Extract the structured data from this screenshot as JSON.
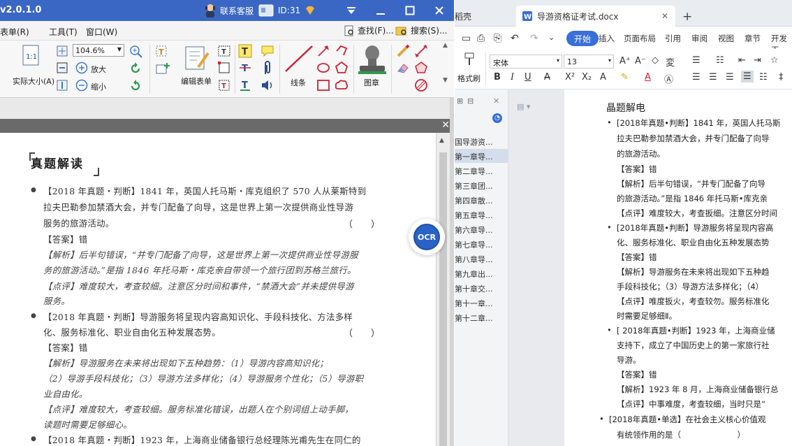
{
  "pdf": {
    "title": {
      "version": "v2.0.1.0",
      "service": "联系客服",
      "id_label": "ID:31"
    },
    "menu": [
      "表单(R)",
      "工具(T)",
      "窗口(W)"
    ],
    "menu_right": [
      "查找(F)...",
      "搜索(S)..."
    ],
    "ribbon": {
      "actual_size": "实际大小(A)",
      "zoom_value": "104.6%",
      "zoom_in": "放大",
      "zoom_out": "缩小",
      "edit_form": "编辑表单",
      "lines": "线条",
      "stamp": "图章"
    },
    "page": {
      "section_title": "真题解读",
      "lines": [
        "【2018 年真题・判断】1841 年，英国人托马斯・库克组织了 570 人从莱斯特到",
        "拉夫巴勒参加禁酒大会，并专门配备了向导，这是世界上第一次提供商业性导游",
        "服务的旅游活动。",
        "【答案】错",
        "【解析】后半句错误，“并专门配备了向导，这是世界上第一次提供商业性导游服",
        "务的旅游活动。”是指 1846 年托马斯・库克亲自带领一个旅行团到苏格兰旅行。",
        "【点评】难度较大，考查较细。注意区分时间和事件，“禁酒大会”并未提供导游",
        "服务。",
        "【2018 年真题・判断】导游服务将呈现内容高知识化、手段科技化、方法多样",
        "化、服务标准化、职业自由化五种发展态势。",
        "【答案】错",
        "【解析】导游服务在未来将出现如下五种趋势：（1）导游内容高知识化；",
        "（2）导游手段科技化；（3）导游方法多样化；（4）导游服务个性化；（5）导游职",
        "业自由化。",
        "【点评】难度较大，考查较细。服务标准化错误，出题人在个别词组上动手脚，",
        "读题时需要足够细心。",
        "【2018 年真题・判断】1923 年，上海商业储备银行总经理陈光甫先生在同仁的"
      ],
      "paren": "（　　）"
    },
    "ocr_label": "OCR"
  },
  "wps": {
    "tabs": [
      "稻壳",
      "导游资格证考试.docx"
    ],
    "new_tab": "+",
    "menu": [
      "开始",
      "插入",
      "页面布局",
      "引用",
      "审阅",
      "视图",
      "章节",
      "开发工"
    ],
    "format_painter": "格式刷",
    "font_name": "宋体",
    "font_size": "13",
    "nav": {
      "items": [
        "国导游资...",
        "第一章导...",
        "第二章导...",
        "第三章团...",
        "第四章散...",
        "第五章导...",
        "第六章导...",
        "第七章导...",
        "第八章导...",
        "第九章出...",
        "第十章交...",
        "第十一章...",
        "第十二章..."
      ]
    },
    "doc": {
      "heading": "晶题解电",
      "lines": [
        "[2018年真题•判断】1841 年，英国人托马斯",
        "拉夫巴勒参加禁酒大会，并专门配备了向导",
        "的旅游活动。",
        "【答案】错",
        "【解析】后半句错误，“并专门配备了向导",
        "的旅游活动。”是指 1846 年托马斯•库克亲",
        "【点评】难度较大，考查扳细。注意区分时间",
        "[2018年真题•判断】导游服务将呈现内容高",
        "化、服务标准化、职业自由化五种发展态势",
        "【答案】错",
        "【解析】导游服务在未来将出现如下五种趋",
        "手段科技化；（3）导游方法多样化；（4）",
        "【点评】唯度扳火，考查较勿。服务标准化",
        "时需要足够细Ⅱ。",
        "[ 2018年真题•判断】1923 年，上海商业储",
        "支持下，成立了中国历史上的第一家旅行社",
        "导游。",
        "【答案】错",
        "【解析】1923 年 8 月，上海商业储备银行总",
        "【点评】中事难度，考查较细，当时只是“",
        "[2018年真题•单选】在社会主义核心价值观",
        "有统领作用的是（　　　　　　　）"
      ]
    }
  },
  "colors": {
    "pdf_title_bg": "#3a67c3",
    "wps_accent": "#3a6fd8",
    "ocr_blue": "#2a63c8"
  }
}
